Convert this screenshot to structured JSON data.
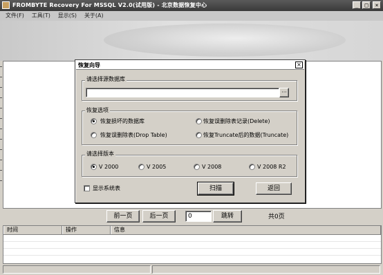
{
  "window": {
    "title": "FROMBYTE Recovery For MSSQL V2.0(试用版) - 北京数据恢复中心",
    "min_glyph": "_",
    "max_glyph": "□",
    "close_glyph": "×"
  },
  "menu": [
    "文件(F)",
    "工具(T)",
    "显示(S)",
    "关于(A)"
  ],
  "dialog": {
    "title": "恢复向导",
    "close_glyph": "×",
    "source_group": "请选择源数据库",
    "source_value": "",
    "browse_label": "···",
    "options_group": "恢复选项",
    "options": [
      {
        "label": "恢复损坏的数据库",
        "checked": true
      },
      {
        "label": "恢复误删除表记录(Delete)",
        "checked": false
      },
      {
        "label": "恢复误删除表(Drop Table)",
        "checked": false
      },
      {
        "label": "恢复Truncate后的数据(Truncate)",
        "checked": false
      }
    ],
    "version_group": "请选择版本",
    "versions": [
      {
        "label": "V 2000",
        "checked": true
      },
      {
        "label": "V 2005",
        "checked": false
      },
      {
        "label": "V 2008",
        "checked": false
      },
      {
        "label": "V 2008 R2",
        "checked": false
      }
    ],
    "show_system_tables": "显示系统表",
    "show_system_checked": false,
    "scan_label": "扫描",
    "back_label": "返回"
  },
  "pager": {
    "prev_label": "前一页",
    "next_label": "后一页",
    "page_value": "0",
    "jump_label": "跳转",
    "total_label": "共0页"
  },
  "log": {
    "columns": [
      "时间",
      "操作",
      "信息"
    ]
  }
}
